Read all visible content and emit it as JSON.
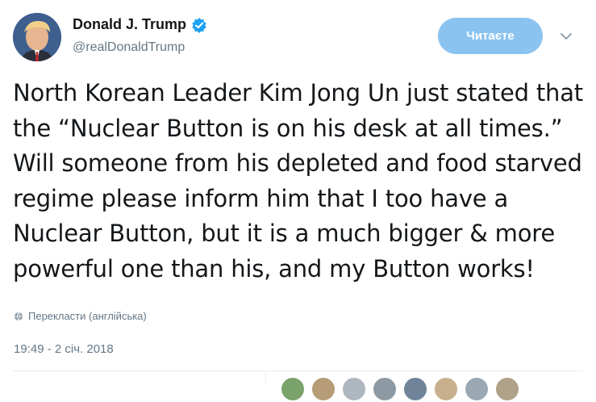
{
  "tweet": {
    "author_name": "Donald J. Trump",
    "author_handle": "@realDonaldTrump",
    "follow_label": "Читаєте",
    "text": "North Korean Leader Kim Jong Un just stated that the “Nuclear Button is on his desk at all times.” Will someone from his depleted and food starved regime please inform him that I too have a Nuclear Button, but it is a much bigger & more powerful one than his, and my Button works!",
    "translate_label": "Перекласти (англійська)",
    "timestamp": "19:49 - 2 січ. 2018"
  },
  "icons": {
    "verified": "verified-badge-icon",
    "caret": "chevron-down-icon",
    "globe": "globe-icon"
  },
  "colors": {
    "accent": "#1da1f2",
    "follow_button": "#8bc3f0",
    "secondary_text": "#657786"
  }
}
